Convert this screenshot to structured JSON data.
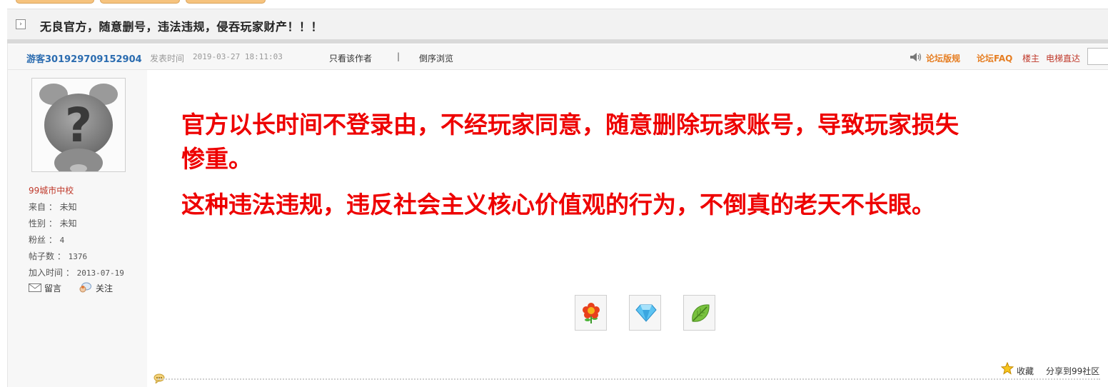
{
  "thread": {
    "title": "无良官方，随意删号，违法违规，侵吞玩家财产！！！"
  },
  "post": {
    "author": "游客301929709152904",
    "time_label": "发表时间",
    "time": "2019-03-27 18:11:03",
    "only_author": "只看该作者",
    "separator": "|",
    "reverse_browse": "倒序浏览"
  },
  "toolbar": {
    "forum_rules": "论坛版规",
    "forum_faq": "论坛FAQ",
    "op": "楼主",
    "elevator": "电梯直达"
  },
  "profile": {
    "rank": "99城市中校",
    "from_label": "来自 ：",
    "from": "未知",
    "gender_label": "性别 ：",
    "gender": "未知",
    "fans_label": "粉丝 ：",
    "fans": "4",
    "posts_label": "帖子数 ：",
    "posts": "1376",
    "joined_label": "加入时间 ：",
    "joined": "2013-07-19",
    "message": "留言",
    "follow": "关注"
  },
  "body": {
    "paragraph1": "官方以长时间不登录由，不经玩家同意，随意删除玩家账号，导致玩家损失惨重。",
    "paragraph2": "这种违法违规，违反社会主义核心价值观的行为，不倒真的老天不长眼。"
  },
  "gifts": [
    "flower-icon",
    "diamond-icon",
    "leaf-icon"
  ],
  "footer": {
    "favorite": "收藏",
    "share": "分享到99社区"
  }
}
